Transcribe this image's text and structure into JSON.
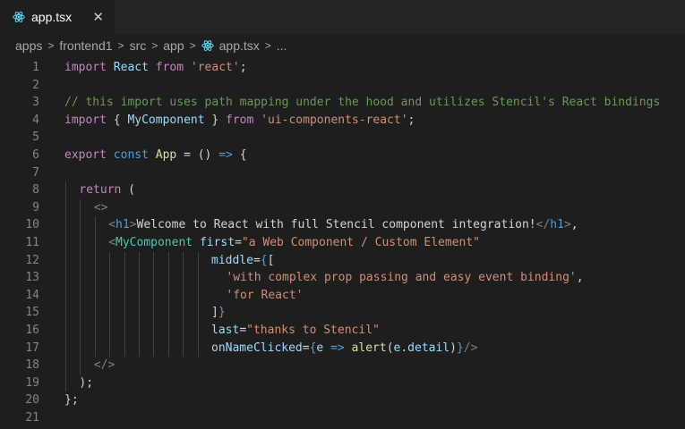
{
  "tab": {
    "label": "app.tsx",
    "close": "✕",
    "icon": "react-icon",
    "icon_color": "#61dafb"
  },
  "breadcrumb": {
    "items": [
      "apps",
      "frontend1",
      "src",
      "app"
    ],
    "file": "app.tsx",
    "more": "..."
  },
  "colors": {
    "background": "#1e1e1e",
    "keyword": "#c586c0",
    "string": "#ce9178",
    "comment": "#6a9955",
    "variable": "#9cdcfe",
    "component": "#4ec9b0"
  },
  "lines": [
    {
      "n": "1",
      "indent": 0,
      "tokens": [
        [
          "kw",
          "import"
        ],
        [
          "pun",
          " "
        ],
        [
          "var",
          "React"
        ],
        [
          "pun",
          " "
        ],
        [
          "kw",
          "from"
        ],
        [
          "pun",
          " "
        ],
        [
          "str",
          "'react'"
        ],
        [
          "pun",
          ";"
        ]
      ]
    },
    {
      "n": "2",
      "indent": 0,
      "tokens": []
    },
    {
      "n": "3",
      "indent": 0,
      "tokens": [
        [
          "com",
          "// this import uses path mapping under the hood and utilizes Stencil's React bindings"
        ]
      ]
    },
    {
      "n": "4",
      "indent": 0,
      "tokens": [
        [
          "kw",
          "import"
        ],
        [
          "pun",
          " { "
        ],
        [
          "var",
          "MyComponent"
        ],
        [
          "pun",
          " } "
        ],
        [
          "kw",
          "from"
        ],
        [
          "pun",
          " "
        ],
        [
          "str",
          "'ui-components-react'"
        ],
        [
          "pun",
          ";"
        ]
      ]
    },
    {
      "n": "5",
      "indent": 0,
      "tokens": []
    },
    {
      "n": "6",
      "indent": 0,
      "tokens": [
        [
          "kw",
          "export"
        ],
        [
          "pun",
          " "
        ],
        [
          "kw2",
          "const"
        ],
        [
          "pun",
          " "
        ],
        [
          "fn",
          "App"
        ],
        [
          "pun",
          " = () "
        ],
        [
          "kw2",
          "=>"
        ],
        [
          "pun",
          " {"
        ]
      ]
    },
    {
      "n": "7",
      "indent": 0,
      "tokens": []
    },
    {
      "n": "8",
      "indent": 1,
      "tokens": [
        [
          "kw",
          "return"
        ],
        [
          "pun",
          " ("
        ]
      ]
    },
    {
      "n": "9",
      "indent": 2,
      "tokens": [
        [
          "tag",
          "<>"
        ]
      ]
    },
    {
      "n": "10",
      "indent": 3,
      "tokens": [
        [
          "tag",
          "<"
        ],
        [
          "tagn",
          "h1"
        ],
        [
          "tag",
          ">"
        ],
        [
          "txt",
          "Welcome to React with full Stencil component integration!"
        ],
        [
          "tag",
          "</"
        ],
        [
          "tagn",
          "h1"
        ],
        [
          "tag",
          ">"
        ],
        [
          "pun",
          ","
        ]
      ]
    },
    {
      "n": "11",
      "indent": 3,
      "tokens": [
        [
          "tag",
          "<"
        ],
        [
          "comp",
          "MyComponent"
        ],
        [
          "pun",
          " "
        ],
        [
          "attr",
          "first"
        ],
        [
          "pun",
          "="
        ],
        [
          "str",
          "\"a Web Component / Custom Element\""
        ]
      ]
    },
    {
      "n": "12",
      "indent": 10,
      "tokens": [
        [
          "attr",
          "middle"
        ],
        [
          "pun",
          "="
        ],
        [
          "brc",
          "{"
        ],
        [
          "pun",
          "["
        ]
      ]
    },
    {
      "n": "13",
      "indent": 11,
      "tokens": [
        [
          "str",
          "'with complex prop passing and easy event binding'"
        ],
        [
          "pun",
          ","
        ]
      ]
    },
    {
      "n": "14",
      "indent": 11,
      "tokens": [
        [
          "str",
          "'for React'"
        ]
      ]
    },
    {
      "n": "15",
      "indent": 10,
      "tokens": [
        [
          "pun",
          "]"
        ],
        [
          "brc",
          "}"
        ]
      ]
    },
    {
      "n": "16",
      "indent": 10,
      "tokens": [
        [
          "attr",
          "last"
        ],
        [
          "pun",
          "="
        ],
        [
          "str",
          "\"thanks to Stencil\""
        ]
      ]
    },
    {
      "n": "17",
      "indent": 10,
      "tokens": [
        [
          "attr",
          "onNameClicked"
        ],
        [
          "pun",
          "="
        ],
        [
          "brc",
          "{"
        ],
        [
          "attr",
          "e"
        ],
        [
          "pun",
          " "
        ],
        [
          "kw2",
          "=>"
        ],
        [
          "pun",
          " "
        ],
        [
          "fn",
          "alert"
        ],
        [
          "pun",
          "("
        ],
        [
          "attr",
          "e"
        ],
        [
          "pun",
          "."
        ],
        [
          "attr",
          "detail"
        ],
        [
          "pun",
          ")"
        ],
        [
          "brc",
          "}"
        ],
        [
          "tag",
          "/>"
        ]
      ]
    },
    {
      "n": "18",
      "indent": 2,
      "tokens": [
        [
          "tag",
          "</>"
        ]
      ]
    },
    {
      "n": "19",
      "indent": 1,
      "tokens": [
        [
          "pun",
          ");"
        ]
      ]
    },
    {
      "n": "20",
      "indent": 0,
      "tokens": [
        [
          "pun",
          "};"
        ]
      ]
    },
    {
      "n": "21",
      "indent": 0,
      "tokens": []
    }
  ]
}
